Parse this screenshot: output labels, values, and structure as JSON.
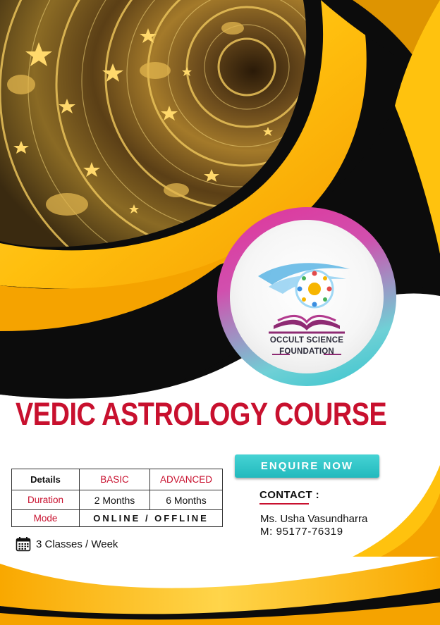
{
  "title": "VEDIC ASTROLOGY COURSE",
  "logo": {
    "line1": "OCCULT SCIENCE",
    "line2": "FOUNDATION"
  },
  "enquire_label": "ENQUIRE NOW",
  "table": {
    "header": [
      "Details",
      "BASIC",
      "ADVANCED"
    ],
    "duration_label": "Duration",
    "duration_basic": "2 Months",
    "duration_advanced": "6 Months",
    "mode_label": "Mode",
    "mode_value": "ONLINE / OFFLINE"
  },
  "classes": {
    "icon": "calendar-icon",
    "text": "3 Classes / Week"
  },
  "contact": {
    "label": "CONTACT :",
    "name": "Ms. Usha Vasundharra",
    "phone": "M:  95177-76319"
  },
  "colors": {
    "title_red": "#c8102e",
    "accent_yellow": "#ffc20e",
    "accent_orange": "#f7a600",
    "teal": "#2cc3c8",
    "magenta": "#e0359a",
    "dark": "#0c0c0c"
  }
}
